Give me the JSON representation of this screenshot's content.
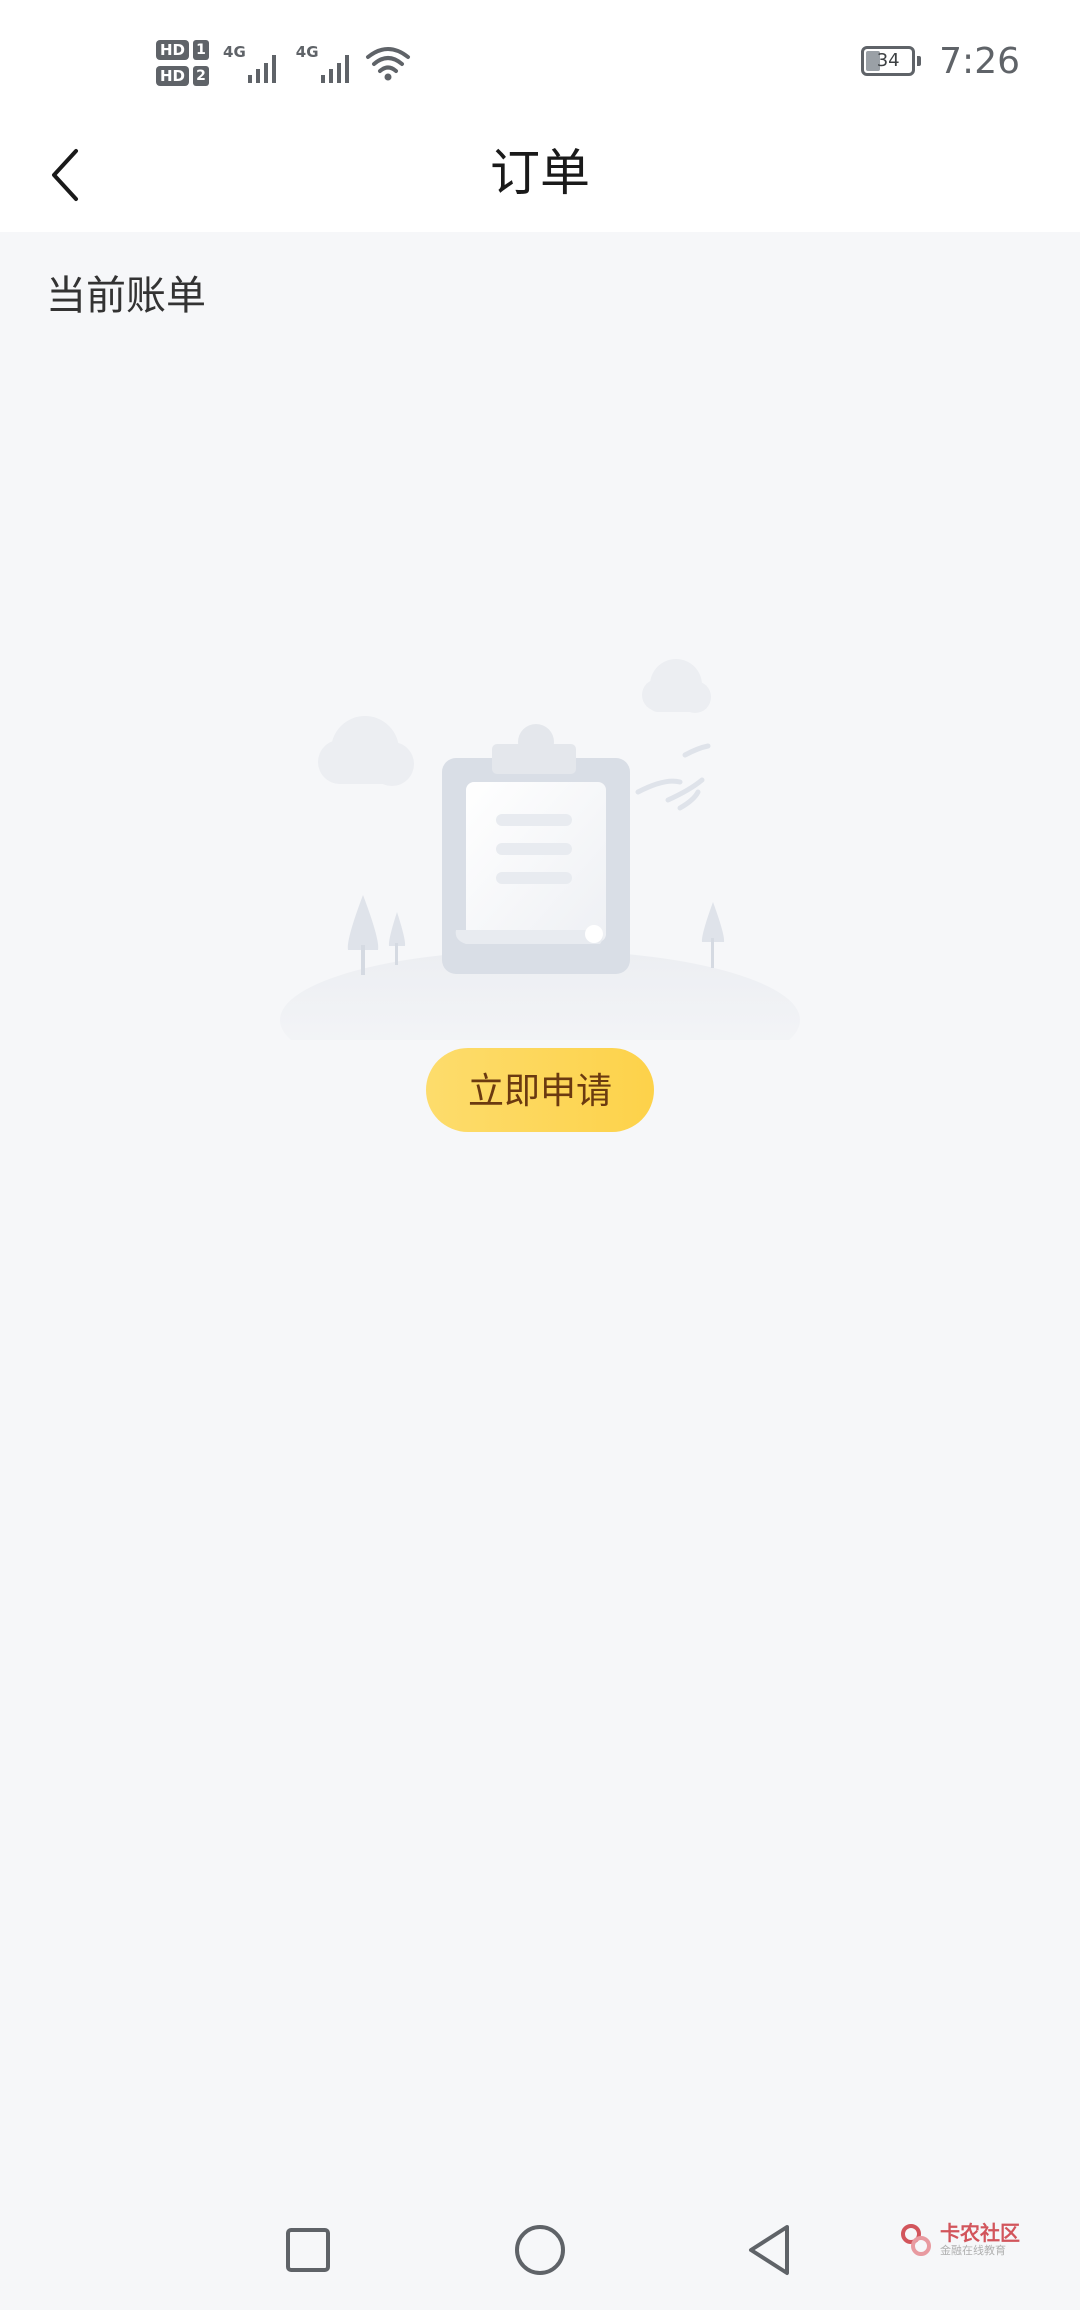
{
  "status_bar": {
    "sim1_badge": "HD",
    "sim1_number": "1",
    "sim2_badge": "HD",
    "sim2_number": "2",
    "network1": "4G",
    "network2": "4G",
    "battery_level": "34",
    "time": "7:26"
  },
  "header": {
    "title": "订单"
  },
  "content": {
    "section_title": "当前账单",
    "apply_button_label": "立即申请"
  },
  "watermark": {
    "brand": "卡农社区",
    "tagline": "金融在线教育"
  },
  "colors": {
    "accent": "#fdd24a",
    "button_text": "#6b3a10",
    "background": "#f6f7f9"
  }
}
